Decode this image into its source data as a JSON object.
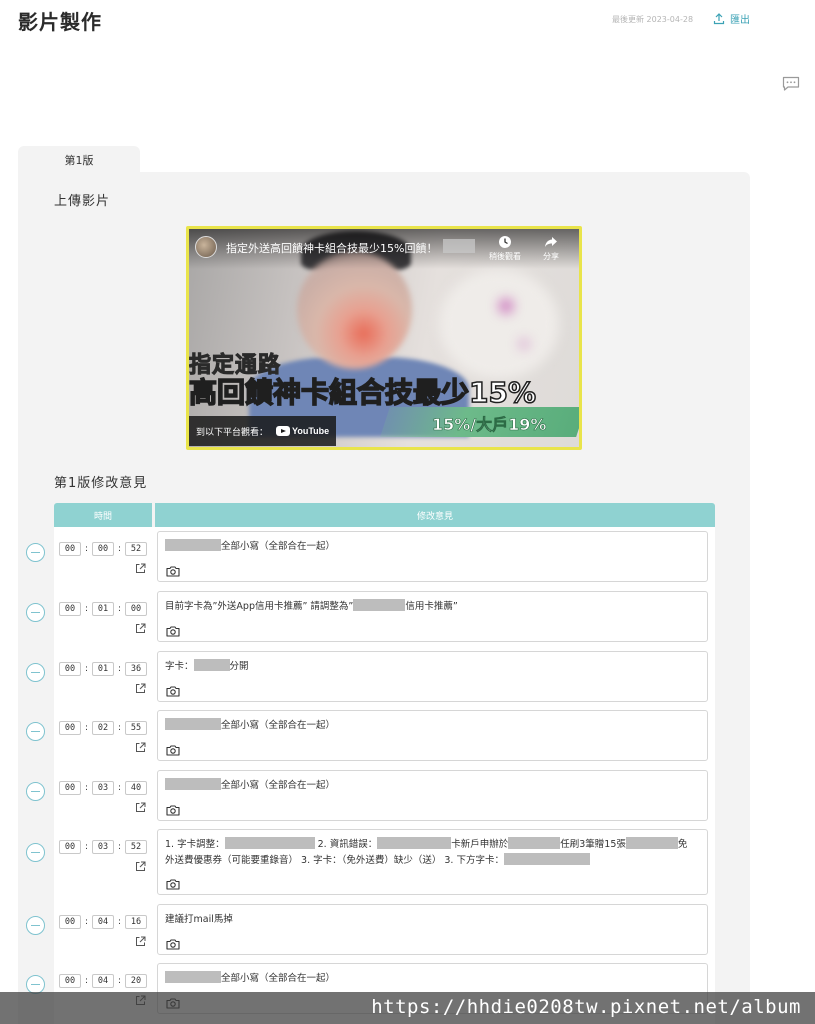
{
  "header": {
    "title": "影片製作",
    "last_updated": "最後更新 2023-04-28",
    "export_label": "匯出"
  },
  "version_tab": {
    "label": "第1版"
  },
  "upload_section": {
    "title": "上傳影片"
  },
  "video": {
    "title": "指定外送高回饋神卡組合技最少15%回饋！",
    "watch_later": "稍後觀看",
    "share": "分享",
    "overlay_line1": "指定通路",
    "overlay_line2": "高回饋神卡組合技最少15%",
    "overlay_line3": "15%/大戶19%",
    "watch_on": "到以下平台觀看：",
    "youtube": "YouTube"
  },
  "feedback_section": {
    "title": "第1版修改意見"
  },
  "table": {
    "col_time": "時間",
    "col_comment": "修改意見",
    "rows": [
      {
        "h": "00",
        "m": "00",
        "s": "52",
        "text_pre": "",
        "text_post": "全部小寫（全部合在一起）"
      },
      {
        "h": "00",
        "m": "01",
        "s": "00",
        "text_pre": "目前字卡為”外送App信用卡推薦” 請調整為”",
        "text_post": "信用卡推薦”"
      },
      {
        "h": "00",
        "m": "01",
        "s": "36",
        "text_pre": "字卡：",
        "text_post": "分開"
      },
      {
        "h": "00",
        "m": "02",
        "s": "55",
        "text_pre": "",
        "text_post": "全部小寫（全部合在一起）"
      },
      {
        "h": "00",
        "m": "03",
        "s": "40",
        "text_pre": "",
        "text_post": "全部小寫（全部合在一起）"
      },
      {
        "h": "00",
        "m": "03",
        "s": "52",
        "p1": "1. 字卡調整：",
        "p2": "2. 資訊錯誤：",
        "p3": "卡新戶申辦於",
        "p4": "任刷3筆贈15張",
        "p5": "免",
        "p6": "外送費優惠券（可能要重錄音） 3. 字卡：（免外送費）缺少（送） 3. 下方字卡："
      },
      {
        "h": "00",
        "m": "04",
        "s": "16",
        "text_pre": "建議打mail馬掉",
        "text_post": ""
      },
      {
        "h": "00",
        "m": "04",
        "s": "20",
        "text_pre": "",
        "text_post": "全部小寫（全部合在一起）"
      }
    ]
  },
  "watermark": "https://hhdie0208tw.pixnet.net/album",
  "colors": {
    "accent": "#3ba2b5",
    "table_header": "#8fd2d1",
    "panel_bg": "#f3f3f3"
  }
}
